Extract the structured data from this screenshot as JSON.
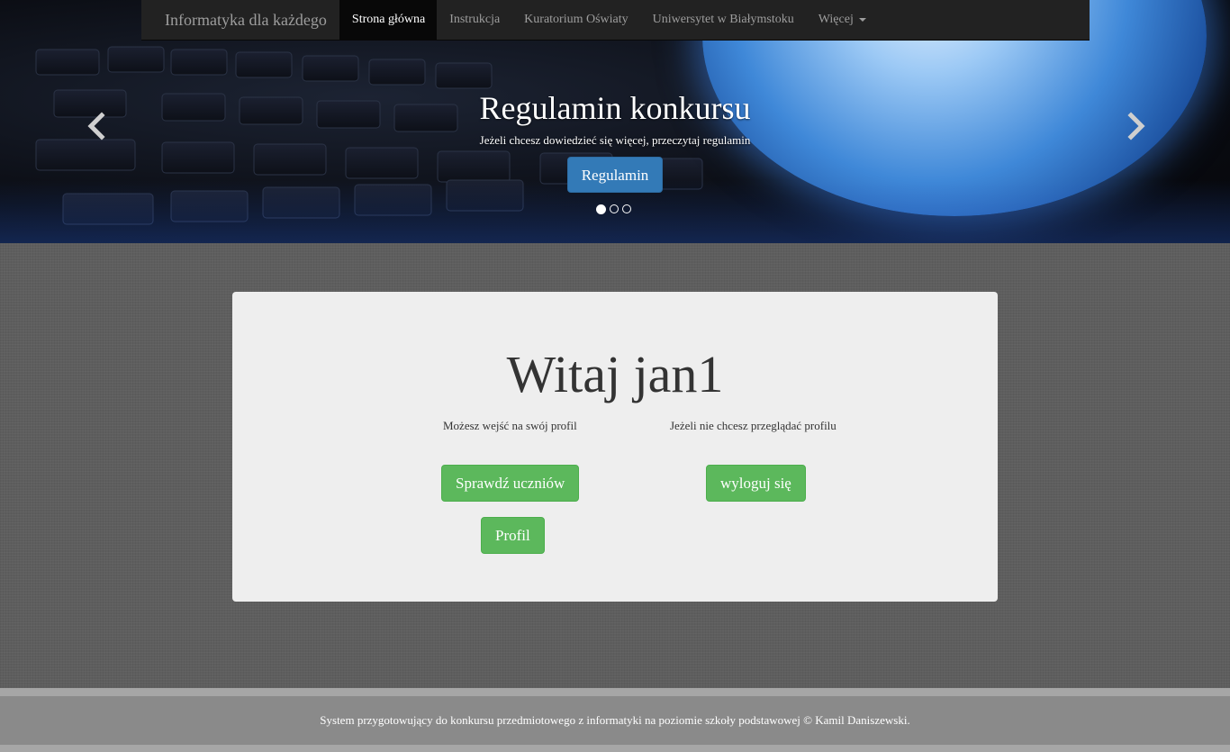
{
  "navbar": {
    "brand": "Informatyka dla każdego",
    "items": [
      {
        "label": "Strona główna",
        "active": true
      },
      {
        "label": "Instrukcja",
        "active": false
      },
      {
        "label": "Kuratorium Oświaty",
        "active": false
      },
      {
        "label": "Uniwersytet w Białymstoku",
        "active": false
      },
      {
        "label": "Więcej",
        "active": false,
        "dropdown": true
      }
    ]
  },
  "carousel": {
    "title": "Regulamin konkursu",
    "text": "Jeżeli chcesz dowiedzieć się więcej, przeczytaj regulamin",
    "button": "Regulamin",
    "slide_count": 3,
    "active_slide": 1,
    "prev_icon": "chevron-left-icon",
    "next_icon": "chevron-right-icon"
  },
  "main": {
    "welcome": "Witaj jan1",
    "left_text": "Możesz wejść na swój profil",
    "right_text": "Jeżeli nie chcesz przeglądać profilu",
    "check_students_button": "Sprawdź uczniów",
    "profile_button": "Profil",
    "logout_button": "wyloguj się"
  },
  "footer": {
    "text": "System przygotowujący do konkursu przedmiotowego z informatyki na poziomie szkoły podstawowej © Kamil Daniszewski."
  },
  "colors": {
    "navbar": "#222222",
    "primary": "#337ab7",
    "success": "#5cb85c",
    "panel": "#eeeeee",
    "footer": "#8a8a8a"
  }
}
